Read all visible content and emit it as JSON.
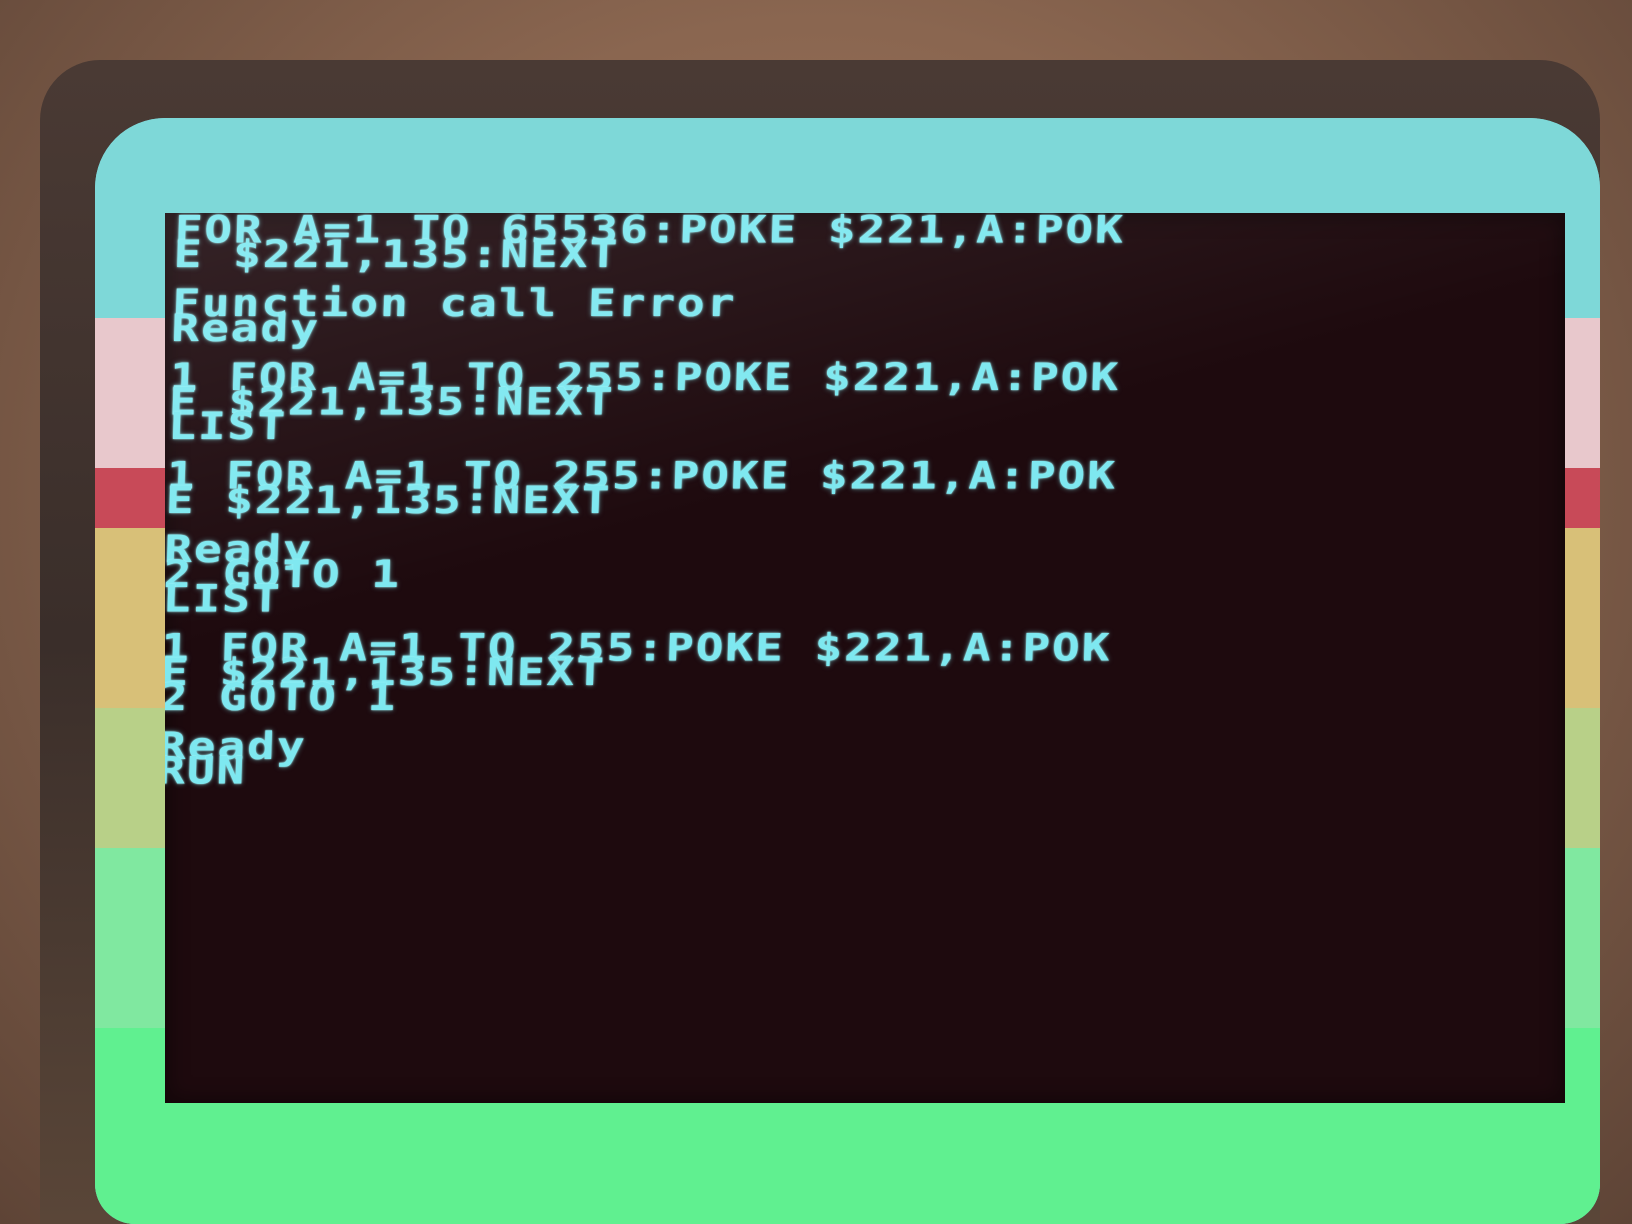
{
  "screen": {
    "lines": [
      "FOR A=1 TO 65536:POKE $221,A:POK",
      "E $221,135:NEXT",
      "",
      "Function call Error",
      "Ready",
      "",
      "1 FOR A=1 TO 255:POKE $221,A:POK",
      "E $221,135:NEXT",
      "LIST",
      "",
      "1 FOR A=1 TO 255:POKE $221,A:POK",
      "E $221,135:NEXT",
      "",
      "Ready",
      "2 GOTO 1",
      "LIST",
      "",
      "1 FOR A=1 TO 255:POKE $221,A:POK",
      "E $221,135:NEXT",
      "2 GOTO 1",
      "",
      "Ready",
      "RUN"
    ]
  },
  "colors": {
    "text": "#7ee8f0",
    "background": "#1e0a0e",
    "border_bands": [
      "#7ed8d8",
      "#e8c8cc",
      "#c84a58",
      "#d8c078",
      "#b8d088",
      "#80e8a0",
      "#60f090"
    ]
  }
}
